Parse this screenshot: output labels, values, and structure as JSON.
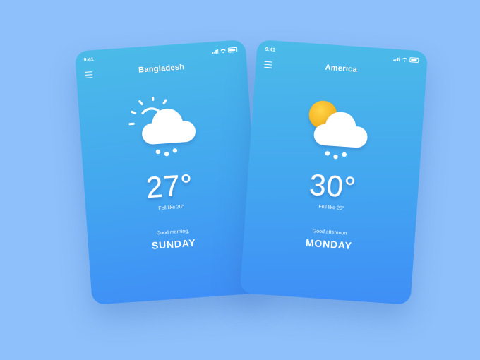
{
  "colors": {
    "background": "#8ec0fb",
    "sun": "#f4b81a"
  },
  "screens": [
    {
      "status_time": "9:41",
      "city": "Bangladesh",
      "icon": "sun-outline-cloud-rain-icon",
      "temperature": "27°",
      "feels_like": "Fell like 20°",
      "greeting": "Good morning,",
      "day": "SUNDAY"
    },
    {
      "status_time": "9:41",
      "city": "America",
      "icon": "sun-cloud-rain-icon",
      "temperature": "30°",
      "feels_like": "Fell like 25°",
      "greeting": "Good afternoon",
      "day": "MONDAY"
    }
  ]
}
